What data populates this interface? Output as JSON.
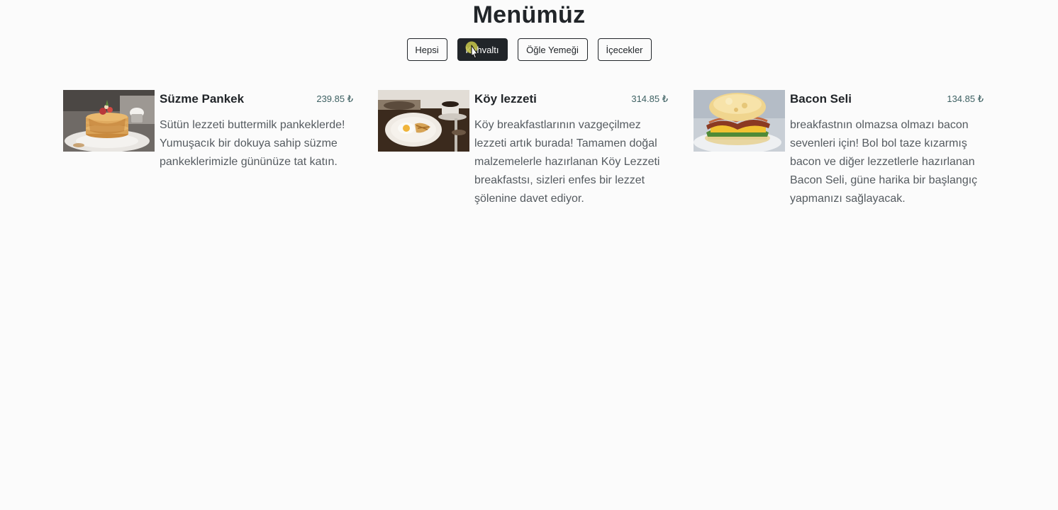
{
  "page": {
    "title": "Menümüz"
  },
  "filters": {
    "all": "Hepsi",
    "breakfast": "Kahvaltı",
    "lunch": "Öğle Yemeği",
    "drinks": "İçecekler",
    "active": "breakfast"
  },
  "items": [
    {
      "name": "Süzme Pankek",
      "price": "239.85 ₺",
      "description": "Sütün lezzeti buttermilk pankeklerde! Yumuşacık bir dokuya sahip süzme pankeklerimizle gününüze tat katın.",
      "image": "pancake-stack-photo"
    },
    {
      "name": "Köy lezzeti",
      "price": "314.85 ₺",
      "description": "Köy breakfastlarının vazgeçilmez lezzeti artık burada! Tamamen doğal malzemelerle hazırlanan Köy Lezzeti breakfastsı, sizleri enfes bir lezzet şölenine davet ediyor.",
      "image": "country-breakfast-photo"
    },
    {
      "name": "Bacon Seli",
      "price": "134.85 ₺",
      "description": "breakfastnın olmazsa olmazı bacon sevenleri için! Bol bol taze kızarmış bacon ve diğer lezzetlerle hazırlanan Bacon Seli, güne harika bir başlangıç yapmanızı sağlayacak.",
      "image": "bacon-sandwich-photo"
    }
  ],
  "colors": {
    "accent": "#212529",
    "price": "#3e6163",
    "cursor_highlight": "#c8c84a"
  }
}
